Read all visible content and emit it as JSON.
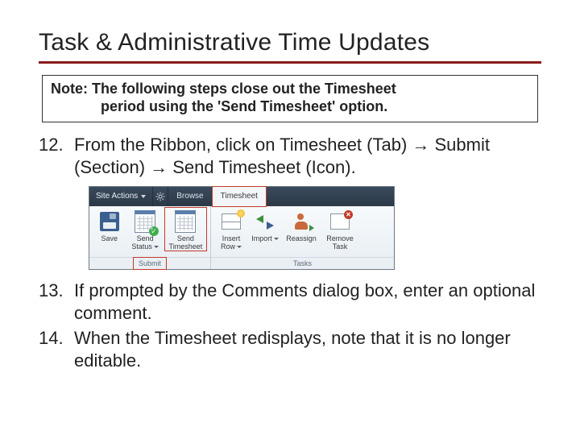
{
  "title": "Task & Administrative Time Updates",
  "note": {
    "prefix": "Note:",
    "line1_rest": " The following steps close out the Timesheet",
    "line2": "period using the 'Send Timesheet' option."
  },
  "steps": [
    {
      "num": "12.",
      "text": "From the Ribbon, click on Timesheet (Tab) → Submit (Section) → Send Timesheet (Icon)."
    },
    {
      "num": "13.",
      "text": "If prompted by the Comments dialog box, enter an optional comment."
    },
    {
      "num": "14.",
      "text": "When the Timesheet redisplays, note that it is no longer editable."
    }
  ],
  "ribbon": {
    "site_actions": "Site Actions",
    "tabs": {
      "browse": "Browse",
      "timesheet": "Timesheet"
    },
    "buttons": {
      "save": "Save",
      "send_status": "Send\nStatus",
      "send_timesheet": "Send\nTimesheet",
      "insert_row": "Insert\nRow",
      "import": "Import",
      "reassign": "Reassign",
      "remove_task": "Remove\nTask"
    },
    "groups": {
      "submit": "Submit",
      "tasks": "Tasks"
    }
  }
}
